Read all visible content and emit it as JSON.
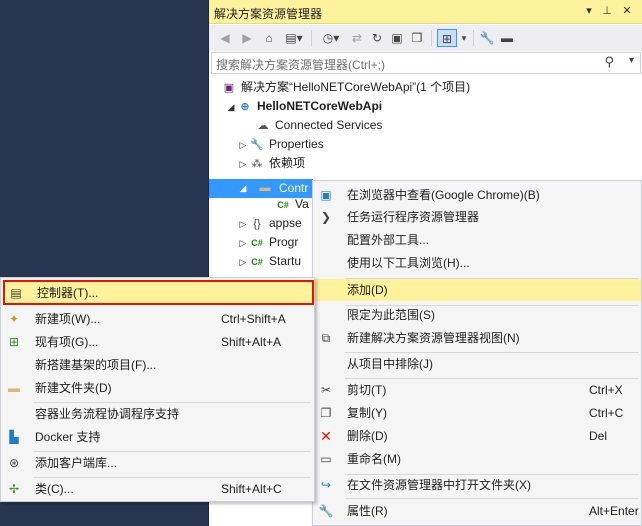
{
  "panel": {
    "title": "解决方案资源管理器",
    "search_placeholder": "搜索解决方案资源管理器(Ctrl+;)"
  },
  "tree": {
    "solution": "解决方案“HelloNETCoreWebApi”(1 个项目)",
    "project": "HelloNETCoreWebApi",
    "connected": "Connected Services",
    "properties": "Properties",
    "deps": "依赖项",
    "controllers": "Contr",
    "values": "Va",
    "appsettings": "appse",
    "program": "Progr",
    "startup": "Startu"
  },
  "context_menu": {
    "items": [
      {
        "label": "在浏览器中查看(Google Chrome)(B)",
        "shortcut": ""
      },
      {
        "label": "任务运行程序资源管理器",
        "shortcut": ""
      },
      {
        "label": "配置外部工具...",
        "shortcut": ""
      },
      {
        "label": "使用以下工具浏览(H)...",
        "shortcut": ""
      },
      {
        "label": "添加(D)",
        "shortcut": ""
      },
      {
        "label": "限定为此范围(S)",
        "shortcut": ""
      },
      {
        "label": "新建解决方案资源管理器视图(N)",
        "shortcut": ""
      },
      {
        "label": "从项目中排除(J)",
        "shortcut": ""
      },
      {
        "label": "剪切(T)",
        "shortcut": "Ctrl+X"
      },
      {
        "label": "复制(Y)",
        "shortcut": "Ctrl+C"
      },
      {
        "label": "删除(D)",
        "shortcut": "Del"
      },
      {
        "label": "重命名(M)",
        "shortcut": ""
      },
      {
        "label": "在文件资源管理器中打开文件夹(X)",
        "shortcut": ""
      },
      {
        "label": "属性(R)",
        "shortcut": "Alt+Enter"
      }
    ]
  },
  "add_submenu": {
    "items": [
      {
        "label": "控制器(T)...",
        "shortcut": ""
      },
      {
        "label": "新建项(W)...",
        "shortcut": "Ctrl+Shift+A"
      },
      {
        "label": "现有项(G)...",
        "shortcut": "Shift+Alt+A"
      },
      {
        "label": "新搭建基架的项目(F)...",
        "shortcut": ""
      },
      {
        "label": "新建文件夹(D)",
        "shortcut": ""
      },
      {
        "label": "容器业务流程协调程序支持",
        "shortcut": ""
      },
      {
        "label": "Docker 支持",
        "shortcut": ""
      },
      {
        "label": "添加客户端库...",
        "shortcut": ""
      },
      {
        "label": "类(C)...",
        "shortcut": "Shift+Alt+C"
      }
    ]
  },
  "colors": {
    "highlight": "#fff29d",
    "selection": "#3399ff",
    "focus_border": "#e51400"
  }
}
